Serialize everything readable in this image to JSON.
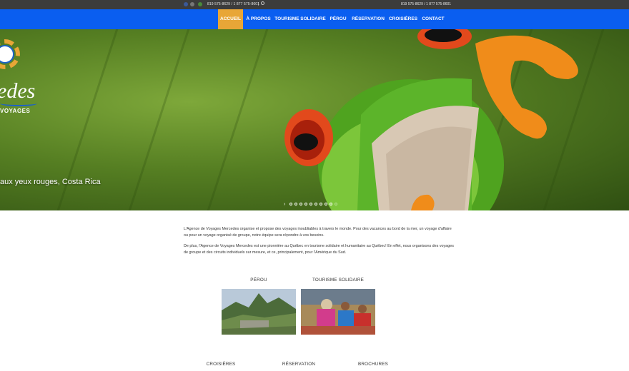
{
  "topbar": {
    "social_icons": [
      "facebook-icon",
      "google-plus-icon",
      "email-icon"
    ],
    "phone_left": "819 575-8629 / 1 877 575-8601",
    "separator": "|",
    "search_icon": "search-icon",
    "phone_right": "819 575-8629 / 1 877 575-8601"
  },
  "nav": {
    "items": [
      "ACCUEIL",
      "À PROPOS",
      "TOURISME SOLIDAIRE",
      "PÉROU",
      "RÉSERVATION",
      "CROISIÈRES",
      "CONTACT"
    ],
    "active_index": 0,
    "colors": {
      "bar": "#0a5ef0",
      "active": "#e8a637"
    }
  },
  "hero": {
    "logo_text": "edes",
    "logo_subtext": "VOYAGES",
    "caption": "aux yeux rouges, Costa Rica",
    "slide_arrow": "›",
    "slide_count": 10,
    "active_slide": 0
  },
  "intro": {
    "paragraph1": "L'Agence de Voyages Mercedes organise et propose des voyages inoubliables à travers le monde. Pour des vacances au bord de la mer, un voyage d'affaire ou pour un voyage organisé de groupe, notre équipe sera répondre à vos besoins.",
    "paragraph2": "De plus, l'Agence de Voyages Mercedes est une pionnière au Québec en tourisme solidaire et humanitaire au Québec! En effet, nous organisons des voyages de groupe et des circuits individuels sur mesure, et ce, principalement, pour l'Amérique du Sud."
  },
  "features": [
    {
      "label": "PÉROU"
    },
    {
      "label": "TOURISME SOLIDAIRE"
    }
  ],
  "bottom_links": [
    "CROISIÈRES",
    "RÉSERVATION",
    "BROCHURES"
  ]
}
